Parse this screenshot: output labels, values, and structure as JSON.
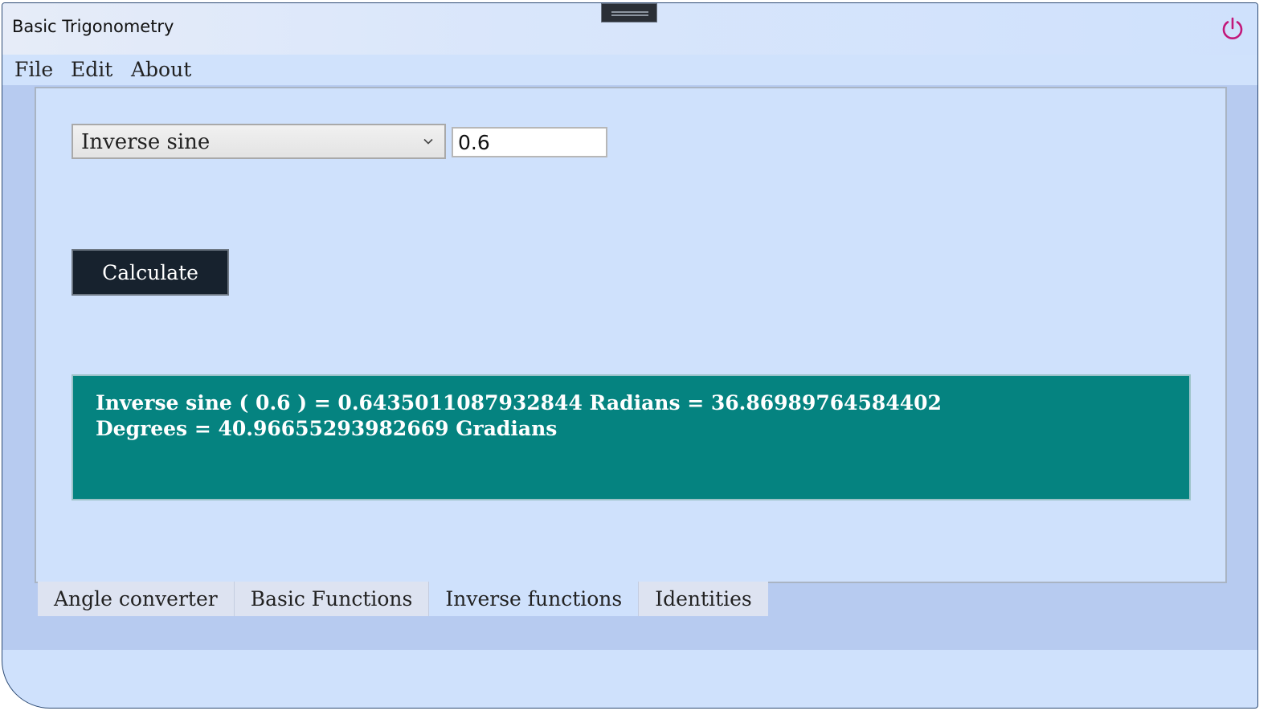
{
  "window": {
    "title": "Basic Trigonometry"
  },
  "menu": {
    "items": [
      {
        "label": "File"
      },
      {
        "label": "Edit"
      },
      {
        "label": "About"
      }
    ]
  },
  "form": {
    "function_select": {
      "selected": "Inverse sine"
    },
    "input_value": "0.6",
    "calculate_label": "Calculate"
  },
  "result": {
    "text": "Inverse sine ( 0.6 ) = 0.6435011087932844 Radians = 36.86989764584402 Degrees = 40.96655293982669 Gradians"
  },
  "tabs": [
    {
      "label": "Angle converter",
      "active": false
    },
    {
      "label": "Basic Functions",
      "active": false
    },
    {
      "label": "Inverse functions",
      "active": true
    },
    {
      "label": "Identities",
      "active": false
    }
  ],
  "icons": {
    "power": "power-icon",
    "dropdown": "chevron-down-icon",
    "drag": "drag-handle-icon"
  },
  "colors": {
    "window_bg": "#cfe1fc",
    "content_bg": "#b7cbf0",
    "result_bg": "#058380",
    "button_bg": "#17222e",
    "power_icon": "#c2187a"
  }
}
